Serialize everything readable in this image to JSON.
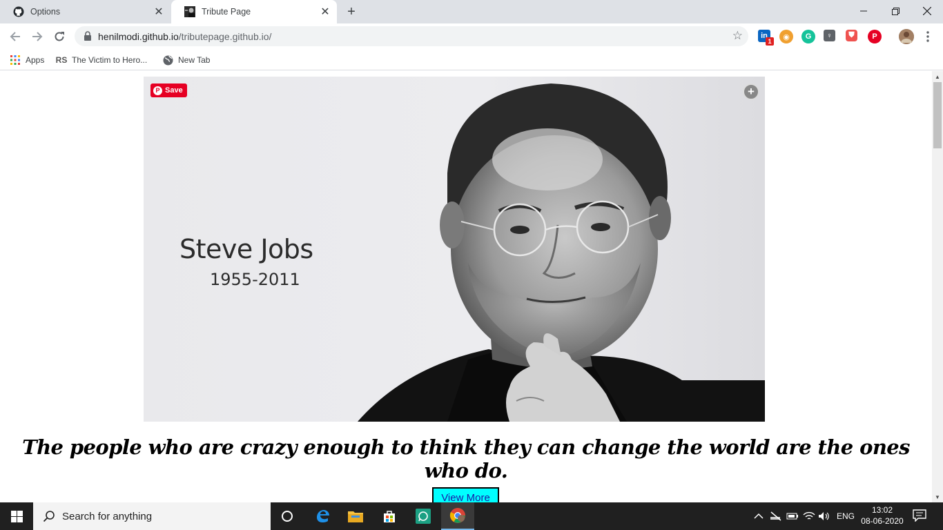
{
  "browser": {
    "tabs": [
      {
        "title": "Options",
        "favicon": "github-icon",
        "active": false
      },
      {
        "title": "Tribute Page",
        "favicon": "steve-jobs-thumbnail",
        "active": true
      }
    ],
    "url_host": "henilmodi.github.io",
    "url_path": "/tributepage.github.io/",
    "bookmarks": [
      {
        "label": "Apps",
        "icon": "apps-grid-icon"
      },
      {
        "label": "The Victim to Hero...",
        "icon": "rs-logo-icon"
      },
      {
        "label": "New Tab",
        "icon": "globe-icon"
      }
    ],
    "extensions": [
      {
        "name": "linkedin-icon",
        "badge": "1",
        "color": "#0a66c2"
      },
      {
        "name": "owl-icon",
        "color": "#f0a030"
      },
      {
        "name": "grammarly-icon",
        "color": "#15c39a"
      },
      {
        "name": "keep-icon",
        "color": "#5f6368"
      },
      {
        "name": "shield-icon",
        "color": "#ef5350"
      },
      {
        "name": "pinterest-icon",
        "color": "#e60023"
      }
    ]
  },
  "page": {
    "hero_name": "Steve Jobs",
    "hero_years": "1955-2011",
    "pin_save_label": "Save",
    "quote": "The people who are crazy enough to think they can change the world are the ones who do.",
    "view_more_label": "View More",
    "colors": {
      "button_bg": "#00ffff",
      "button_text": "#1a1aa6"
    }
  },
  "taskbar": {
    "search_placeholder": "Search for anything",
    "language": "ENG",
    "time": "13:02",
    "date": "08-06-2020",
    "apps": [
      "cortana-icon",
      "edge-icon",
      "file-explorer-icon",
      "store-icon",
      "whatsapp-icon",
      "chrome-icon"
    ]
  }
}
